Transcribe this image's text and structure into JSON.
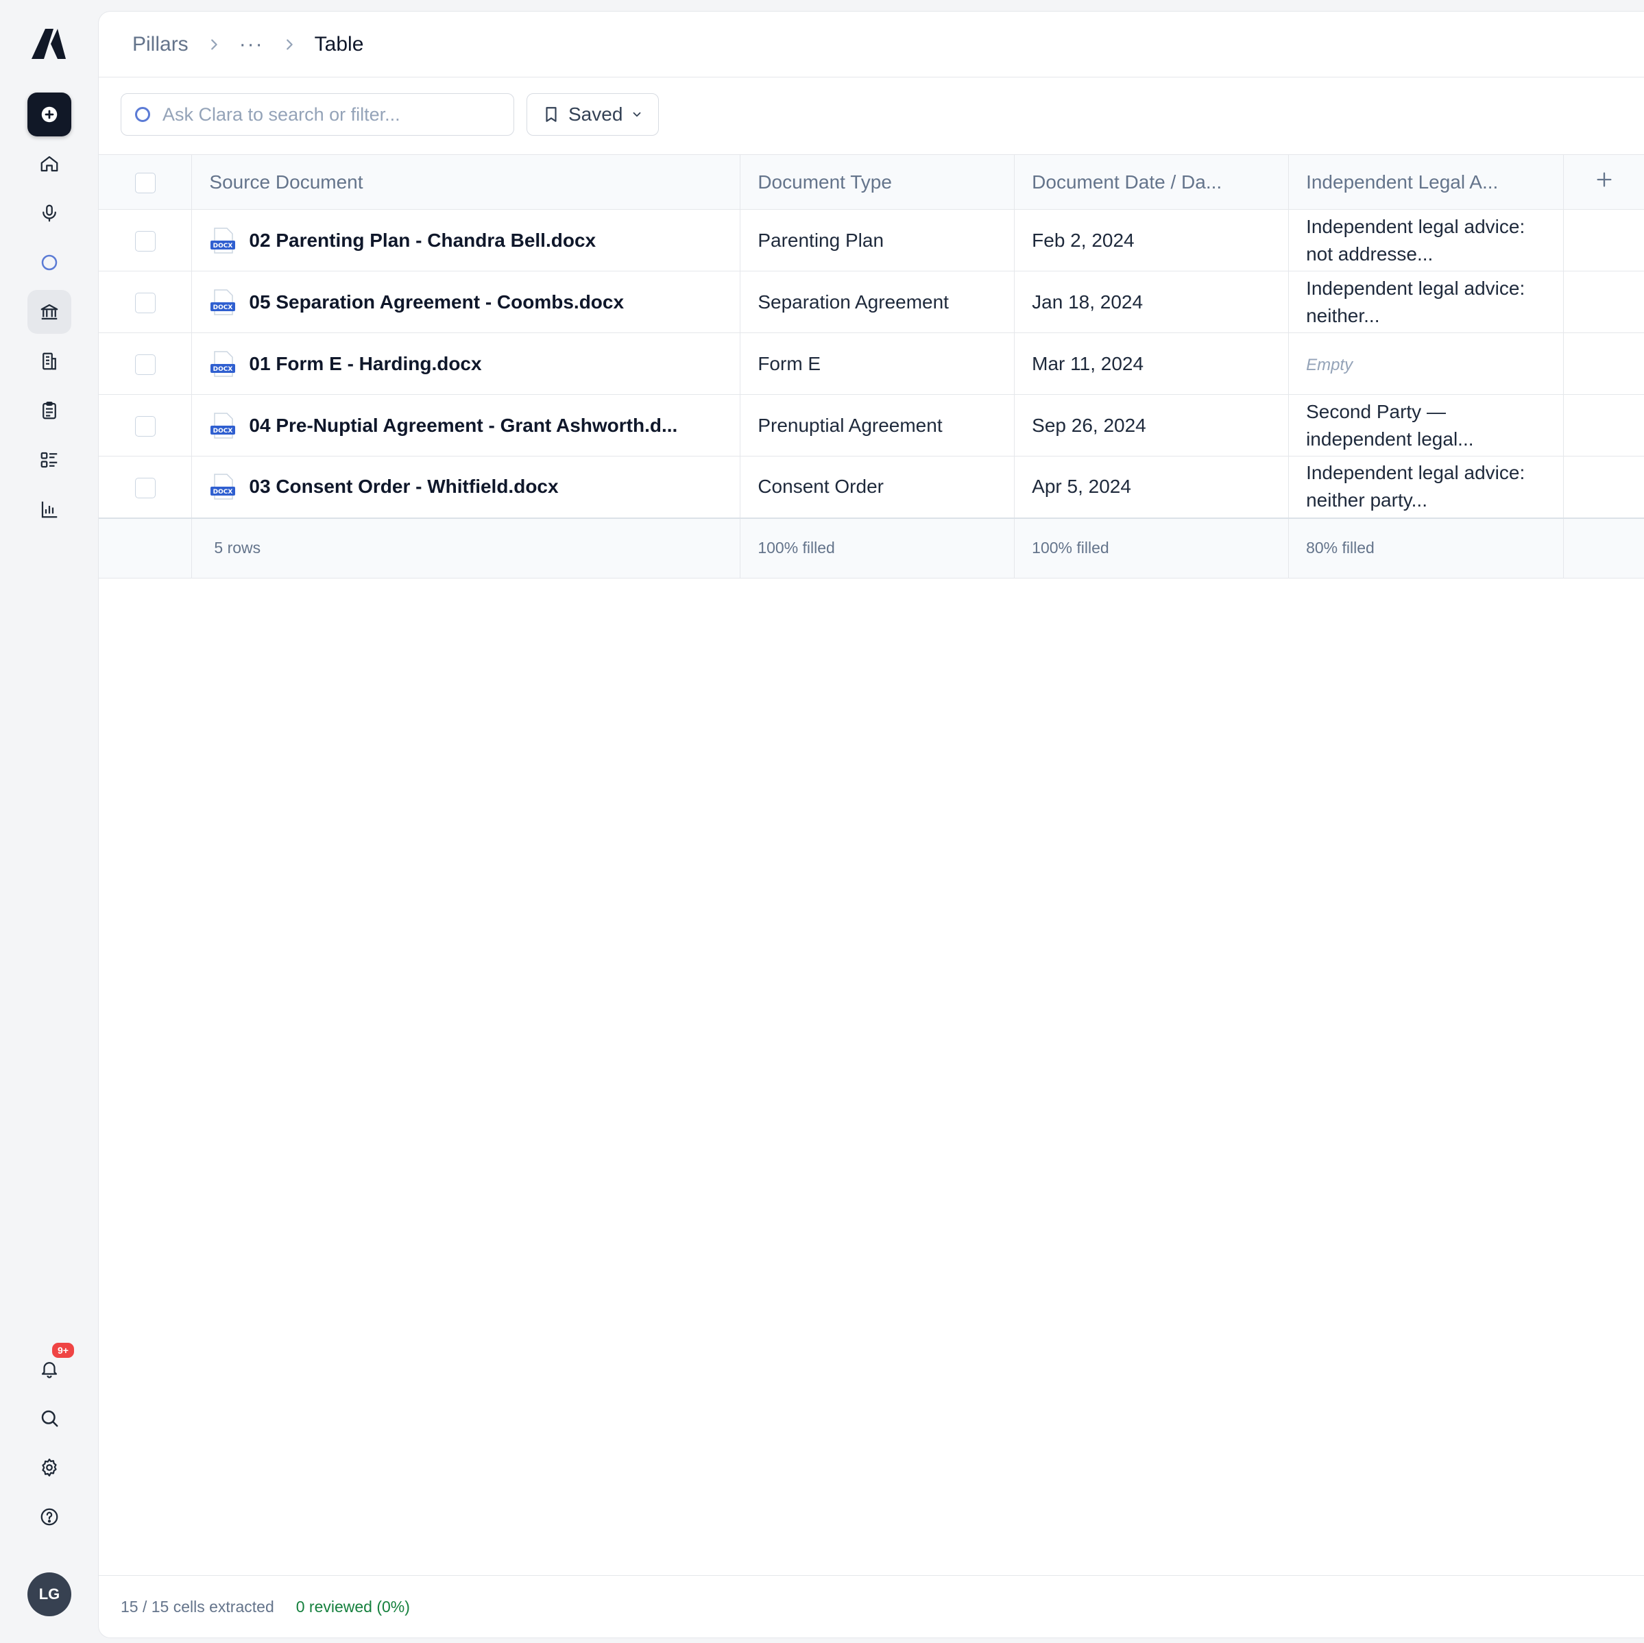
{
  "breadcrumb": {
    "root": "Pillars",
    "ellipsis": "···",
    "current": "Table"
  },
  "search": {
    "placeholder": "Ask Clara to search or filter..."
  },
  "saved_button": {
    "label": "Saved"
  },
  "sidebar": {
    "icons": [
      "app-logo",
      "new-icon",
      "home-icon",
      "microphone-icon",
      "clara-ring-icon",
      "bank-icon",
      "building-icon",
      "clipboard-icon",
      "list-icon",
      "chart-icon"
    ],
    "bottom_icons": [
      "bell-icon",
      "search-icon",
      "gear-icon",
      "help-icon"
    ],
    "notification_badge": "9+",
    "avatar_initials": "LG"
  },
  "table": {
    "columns": [
      "Source Document",
      "Document Type",
      "Document Date / Da...",
      "Independent Legal A..."
    ],
    "add_column": "+",
    "rows": [
      {
        "doc": "02 Parenting Plan - Chandra Bell.docx",
        "type": "Parenting Plan",
        "date": "Feb 2, 2024",
        "ila": "Independent legal advice: not addresse..."
      },
      {
        "doc": "05 Separation Agreement - Coombs.docx",
        "type": "Separation Agreement",
        "date": "Jan 18, 2024",
        "ila": "Independent legal advice: neither..."
      },
      {
        "doc": "01 Form E - Harding.docx",
        "type": "Form E",
        "date": "Mar 11, 2024",
        "ila": "Empty"
      },
      {
        "doc": "04 Pre-Nuptial Agreement - Grant Ashworth.d...",
        "type": "Prenuptial Agreement",
        "date": "Sep 26, 2024",
        "ila": "Second Party — independent legal..."
      },
      {
        "doc": "03 Consent Order - Whitfield.docx",
        "type": "Consent Order",
        "date": "Apr 5, 2024",
        "ila": "Independent legal advice: neither party..."
      }
    ],
    "file_badge": "DOCX",
    "footer": {
      "rows": "5 rows",
      "type_fill": "100% filled",
      "date_fill": "100% filled",
      "ila_fill": "80% filled"
    }
  },
  "status": {
    "extracted": "15 / 15 cells extracted",
    "reviewed": "0 reviewed (0%)"
  },
  "colors": {
    "accent": "#5b7bd5",
    "docx_blue": "#2f5fd0",
    "reviewed_green": "#15803d",
    "badge_red": "#ef4444"
  }
}
